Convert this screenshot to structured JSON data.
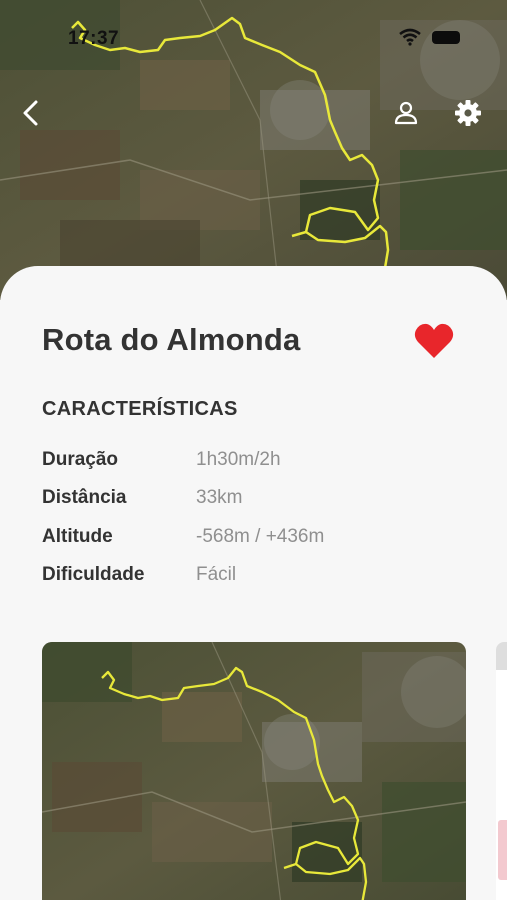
{
  "status_bar": {
    "time": "17:37",
    "wifi_icon": "wifi-icon",
    "battery_icon": "battery-icon"
  },
  "nav": {
    "back_icon": "chevron-left-icon",
    "profile_icon": "user-icon",
    "settings_icon": "gear-icon"
  },
  "route": {
    "title": "Rota do Almonda",
    "favorite_icon": "heart-icon",
    "favorite_color": "#e8262b"
  },
  "characteristics": {
    "heading": "CARACTERÍSTICAS",
    "items": [
      {
        "label": "Duração",
        "value": "1h30m/2h"
      },
      {
        "label": "Distância",
        "value": "33km"
      },
      {
        "label": "Altitude",
        "value": "-568m / +436m"
      },
      {
        "label": "Dificuldade",
        "value": "Fácil"
      }
    ]
  },
  "colors": {
    "route_line": "#e8e83a",
    "card_bg": "#f7f7f7",
    "value_text": "#8f8f8f"
  }
}
